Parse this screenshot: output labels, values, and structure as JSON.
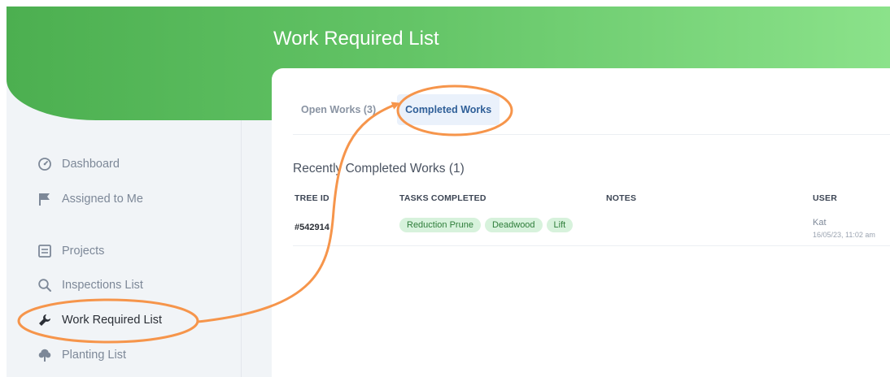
{
  "header": {
    "title": "Work Required List"
  },
  "sidebar": {
    "items": [
      {
        "label": "Dashboard",
        "icon": "dashboard-icon"
      },
      {
        "label": "Assigned to Me",
        "icon": "flag-icon"
      },
      {
        "label": "Projects",
        "icon": "projects-icon"
      },
      {
        "label": "Inspections List",
        "icon": "search-icon"
      },
      {
        "label": "Work Required List",
        "icon": "wrench-icon",
        "active": true
      },
      {
        "label": "Planting List",
        "icon": "tree-icon"
      }
    ]
  },
  "tabs": [
    {
      "label": "Open Works (3)"
    },
    {
      "label": "Completed Works",
      "active": true
    }
  ],
  "section": {
    "title": "Recently Completed Works (1)"
  },
  "table": {
    "headers": [
      "TREE ID",
      "TASKS COMPLETED",
      "NOTES",
      "USER"
    ],
    "rows": [
      {
        "tree_id": "#542914",
        "tasks": [
          "Reduction Prune",
          "Deadwood",
          "Lift"
        ],
        "notes": "",
        "user": "Kat",
        "time": "16/05/23, 11:02 am"
      }
    ]
  },
  "colors": {
    "header_start": "#4caf50",
    "header_end": "#8be28a",
    "chip_bg": "#d7f2dc",
    "chip_text": "#2e7d3a",
    "annotation": "#f6954b"
  }
}
